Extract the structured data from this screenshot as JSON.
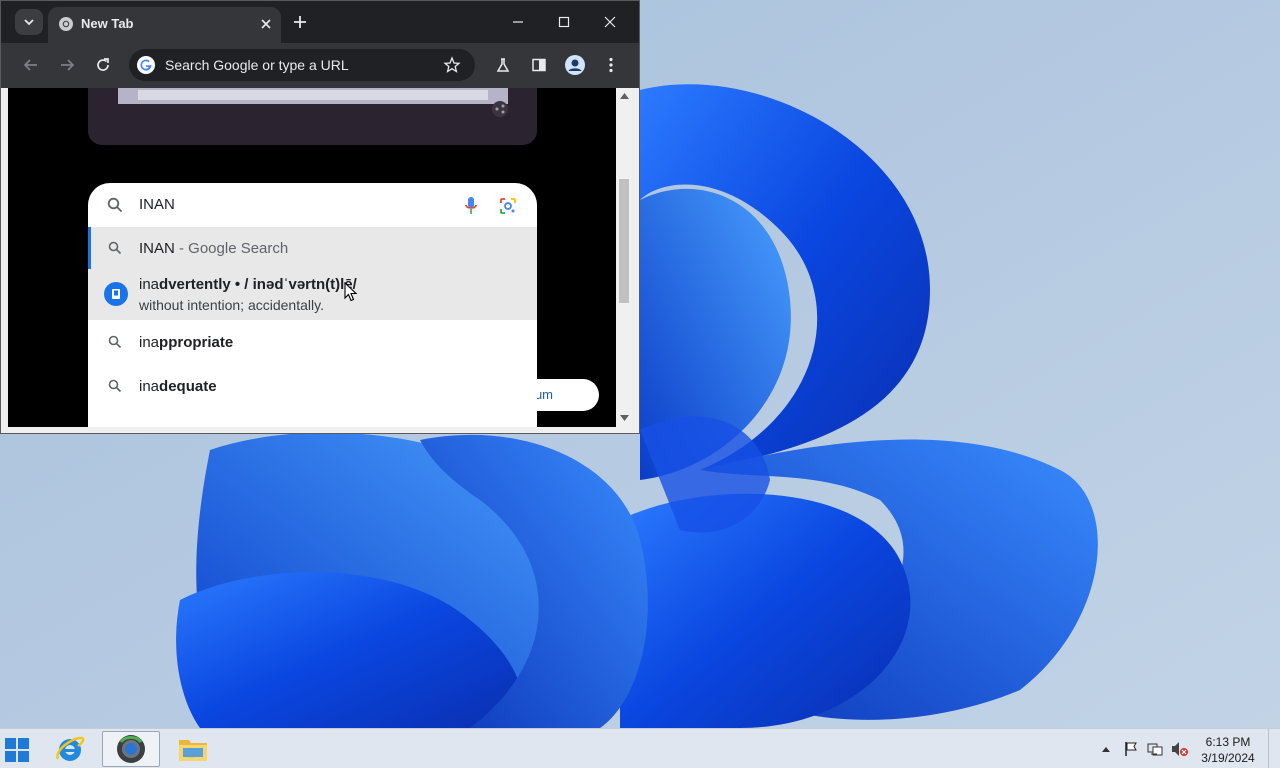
{
  "desktop": {
    "wallpaper": "windows-11-bloom",
    "background_color": "#9fb9d6",
    "bloom_color": "#1a5cf0"
  },
  "browser": {
    "tab": {
      "title": "New Tab",
      "favicon": "chrome-icon"
    },
    "omnibox": {
      "placeholder": "Search Google or type a URL"
    },
    "icons": {
      "tab_search": "chevron-down-icon",
      "new_tab": "plus-icon",
      "back": "back-arrow-icon",
      "forward": "forward-arrow-icon",
      "reload": "reload-icon",
      "bookmark": "star-icon",
      "labs": "flask-icon",
      "side_panel": "side-panel-icon",
      "profile": "profile-icon",
      "menu": "kebab-menu-icon"
    },
    "page": {
      "search_query": "INAN",
      "suggestions": [
        {
          "typed": "INAN",
          "suffix": " - Google Search",
          "icon": "search-icon"
        },
        {
          "typed": "ina",
          "rest": "dvertently • / inədˈvərtn(t)lē/",
          "definition": "without intention; accidentally.",
          "icon": "dictionary-icon"
        },
        {
          "typed": "ina",
          "rest": "ppropriate",
          "icon": "search-icon"
        },
        {
          "typed": "ina",
          "rest": "dequate",
          "icon": "search-icon"
        }
      ],
      "premium_text": "Premium"
    },
    "accent_color": "#1a73e8"
  },
  "taskbar": {
    "apps": [
      "internet-explorer-icon",
      "chrome-icon",
      "file-explorer-icon"
    ],
    "clock_time": "6:13 PM",
    "clock_date": "3/19/2024"
  }
}
